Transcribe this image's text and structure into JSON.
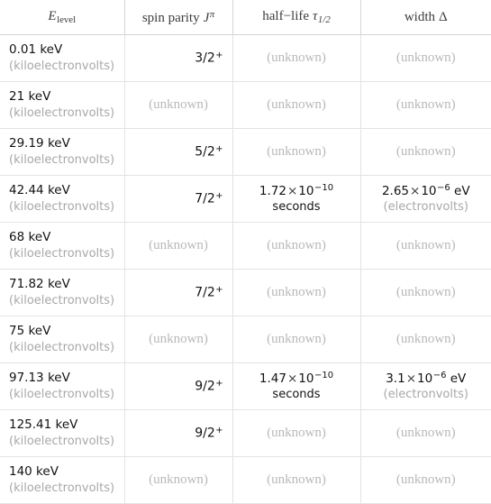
{
  "table": {
    "columns": [
      {
        "id": "energy",
        "label_main": "E",
        "label_sub": "level",
        "align": "center"
      },
      {
        "id": "spin",
        "label_pre": "spin parity",
        "label_main": "J",
        "label_sup": "π",
        "align": "center"
      },
      {
        "id": "halflife",
        "label_pre": "half−life",
        "label_main": "τ",
        "label_sub": "1/2",
        "align": "center"
      },
      {
        "id": "width",
        "label_pre": "width",
        "label_main": "Δ",
        "align": "center"
      }
    ],
    "unknown_text": "(unknown)",
    "units": {
      "energy": "(kiloelectronvolts)",
      "energy_symbol": "keV",
      "halflife": "seconds",
      "width": "(electronvolts)",
      "width_symbol": "eV"
    },
    "rows": [
      {
        "energy_value": "0.01 keV",
        "energy_unit": "(kiloelectronvolts)",
        "spin": "3/2",
        "spin_parity": "+",
        "halflife": null,
        "width": null
      },
      {
        "energy_value": "21 keV",
        "energy_unit": "(kiloelectronvolts)",
        "spin": null,
        "spin_parity": null,
        "halflife": null,
        "width": null
      },
      {
        "energy_value": "29.19 keV",
        "energy_unit": "(kiloelectronvolts)",
        "spin": "5/2",
        "spin_parity": "+",
        "halflife": null,
        "width": null
      },
      {
        "energy_value": "42.44 keV",
        "energy_unit": "(kiloelectronvolts)",
        "spin": "7/2",
        "spin_parity": "+",
        "halflife": {
          "mantissa": "1.72",
          "exponent": "−10",
          "unit": "seconds"
        },
        "width": {
          "mantissa": "2.65",
          "exponent": "−6",
          "symbol": "eV",
          "unit": "(electronvolts)"
        }
      },
      {
        "energy_value": "68 keV",
        "energy_unit": "(kiloelectronvolts)",
        "spin": null,
        "spin_parity": null,
        "halflife": null,
        "width": null
      },
      {
        "energy_value": "71.82 keV",
        "energy_unit": "(kiloelectronvolts)",
        "spin": "7/2",
        "spin_parity": "+",
        "halflife": null,
        "width": null
      },
      {
        "energy_value": "75 keV",
        "energy_unit": "(kiloelectronvolts)",
        "spin": null,
        "spin_parity": null,
        "halflife": null,
        "width": null
      },
      {
        "energy_value": "97.13 keV",
        "energy_unit": "(kiloelectronvolts)",
        "spin": "9/2",
        "spin_parity": "+",
        "halflife": {
          "mantissa": "1.47",
          "exponent": "−10",
          "unit": "seconds"
        },
        "width": {
          "mantissa": "3.1",
          "exponent": "−6",
          "symbol": "eV",
          "unit": "(electronvolts)"
        }
      },
      {
        "energy_value": "125.41 keV",
        "energy_unit": "(kiloelectronvolts)",
        "spin": "9/2",
        "spin_parity": "+",
        "halflife": null,
        "width": null
      },
      {
        "energy_value": "140 keV",
        "energy_unit": "(kiloelectronvolts)",
        "spin": null,
        "spin_parity": null,
        "halflife": null,
        "width": null
      }
    ]
  },
  "colors": {
    "text": "#121212",
    "muted": "#a8a8a8",
    "unknown": "#b9b9b9",
    "header_text": "#3d3d3d",
    "rule": "#e3e3e3",
    "header_rule": "#d4d4d4",
    "background": "#ffffff"
  }
}
